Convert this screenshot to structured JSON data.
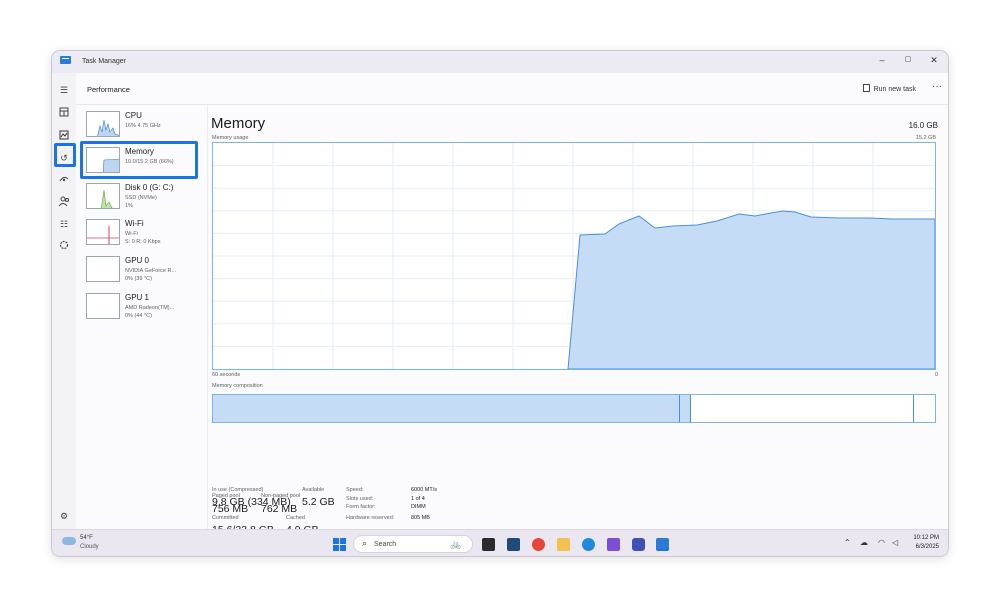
{
  "window": {
    "title": "Task Manager"
  },
  "window_controls": {
    "minimize": "–",
    "maximize": "▢",
    "close": "✕"
  },
  "header": {
    "title": "Performance",
    "run_new_task": "Run new task",
    "more": "···"
  },
  "sidebar": {
    "items": [
      {
        "name": "CPU",
        "sub1": "16% 4.75 GHz",
        "sub2": ""
      },
      {
        "name": "Memory",
        "sub1": "10.0/15.2 GB (66%)",
        "sub2": ""
      },
      {
        "name": "Disk 0 (G: C:)",
        "sub1": "SSD (NVMe)",
        "sub2": "1%"
      },
      {
        "name": "Wi-Fi",
        "sub1": "Wi-Fi",
        "sub2": "S: 0 R: 0 Kbps"
      },
      {
        "name": "GPU 0",
        "sub1": "NVIDIA GeForce R...",
        "sub2": "0% (39 °C)"
      },
      {
        "name": "GPU 1",
        "sub1": "AMD Radeon(TM)...",
        "sub2": "0% (44 °C)"
      }
    ]
  },
  "main": {
    "title": "Memory",
    "total": "16.0 GB",
    "usage_label": "Memory usage",
    "usage_max": "15.2 GB",
    "time_label": "60 seconds",
    "time_end": "0",
    "composition_label": "Memory composition",
    "stats": {
      "in_use_label": "In use (Compressed)",
      "in_use_value": "9.8 GB (334 MB)",
      "available_label": "Available",
      "available_value": "5.2 GB",
      "committed_label": "Committed",
      "committed_value": "15.6/33.8 GB",
      "cached_label": "Cached",
      "cached_value": "4.9 GB",
      "paged_label": "Paged pool",
      "paged_value": "756 MB",
      "nonpaged_label": "Non-paged pool",
      "nonpaged_value": "762 MB"
    },
    "details": [
      {
        "label": "Speed:",
        "value": "6000 MT/s"
      },
      {
        "label": "Slots used:",
        "value": "1 of 4"
      },
      {
        "label": "Form factor:",
        "value": "DIMM"
      },
      {
        "label": "Hardware reserved:",
        "value": "805 MB"
      }
    ]
  },
  "taskbar": {
    "weather_temp": "54°F",
    "weather_desc": "Cloudy",
    "search_placeholder": "Search",
    "time": "10:12 PM",
    "date": "6/3/2025"
  },
  "colors": {
    "accent": "#1a73e8",
    "graph_fill": "#c5dcf7",
    "graph_line": "#4a90d9"
  }
}
